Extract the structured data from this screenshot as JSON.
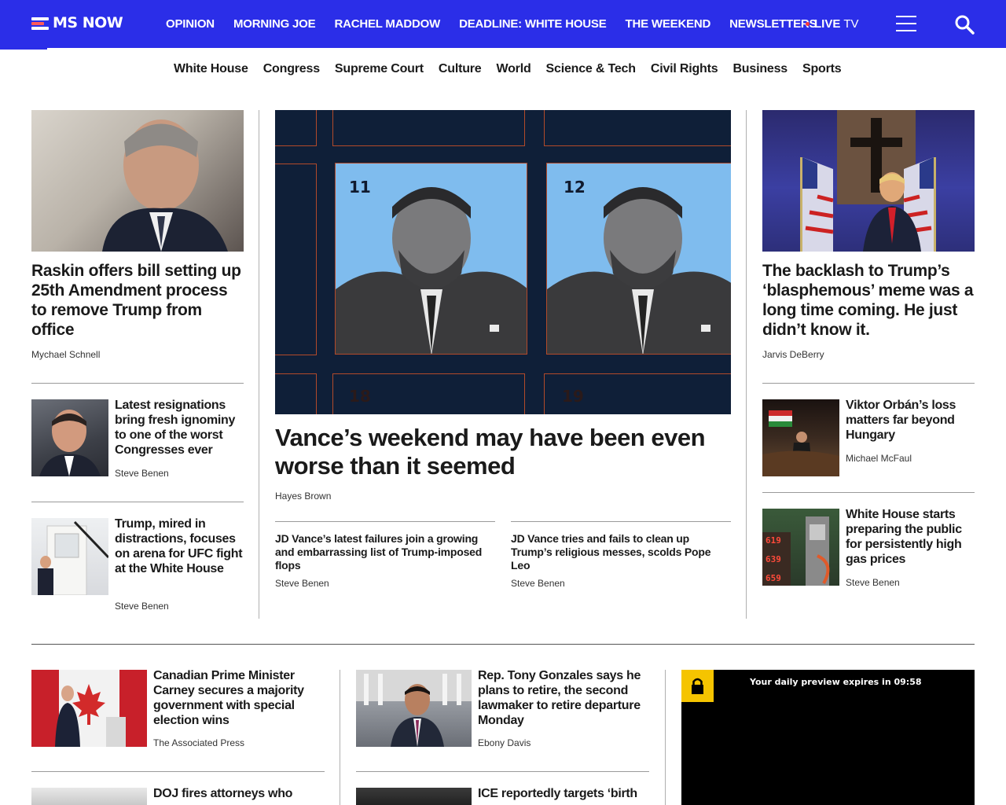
{
  "brand": {
    "logo_text": "MS NOW",
    "accent": "#2b2ee8",
    "live_dot": "#ff3b3b"
  },
  "main_nav": [
    "OPINION",
    "MORNING JOE",
    "RACHEL MADDOW",
    "DEADLINE: WHITE HOUSE",
    "THE WEEKEND",
    "NEWSLETTERS"
  ],
  "live": {
    "live_label": "LIVE",
    "tv_label": "TV"
  },
  "sub_nav": [
    "White House",
    "Congress",
    "Supreme Court",
    "Culture",
    "World",
    "Science & Tech",
    "Civil Rights",
    "Business",
    "Sports"
  ],
  "left_col": {
    "lead": {
      "headline": "Raskin offers bill setting up 25th Amendment process to remove Trump from office",
      "byline": "Mychael Schnell"
    },
    "items": [
      {
        "headline": "Latest resignations bring fresh ignominy to one of the worst Congresses ever",
        "byline": "Steve Benen"
      },
      {
        "headline": "Trump, mired in distractions, focuses on arena for UFC fight at the White House",
        "byline": "Steve Benen"
      }
    ]
  },
  "center_col": {
    "hero": {
      "tile_numbers": [
        "11",
        "12",
        "18",
        "19"
      ],
      "headline": "Vance’s weekend may have been even worse than it seemed",
      "byline": "Hayes Brown"
    },
    "related": [
      {
        "headline": "JD Vance’s latest failures join a growing and embarrassing list of Trump-imposed flops",
        "byline": "Steve Benen"
      },
      {
        "headline": "JD Vance tries and fails to clean up Trump’s religious messes, scolds Pope Leo",
        "byline": "Steve Benen"
      }
    ]
  },
  "right_col": {
    "lead": {
      "headline": "The backlash to Trump’s ‘blasphemous’ meme was a long time coming. He just didn’t know it.",
      "byline": "Jarvis DeBerry"
    },
    "items": [
      {
        "headline": "Viktor Orbán’s loss matters far beyond Hungary",
        "byline": "Michael McFaul"
      },
      {
        "headline": "White House starts preparing the public for persistently high gas prices",
        "byline": "Steve Benen"
      }
    ],
    "gas_prices": [
      "619",
      "639",
      "659"
    ]
  },
  "lower": {
    "col1": [
      {
        "headline": "Canadian Prime Minister Carney secures a majority government with special election wins",
        "byline": "The Associated Press"
      },
      {
        "headline": "DOJ fires attorneys who",
        "byline": ""
      }
    ],
    "col2": [
      {
        "headline": "Rep. Tony Gonzales says he plans to retire, the second lawmaker to retire departure Monday",
        "byline": "Ebony Davis"
      },
      {
        "headline": "ICE reportedly targets ‘birth",
        "byline": ""
      }
    ]
  },
  "player": {
    "preview_text": "Your daily preview expires in 09:58"
  }
}
